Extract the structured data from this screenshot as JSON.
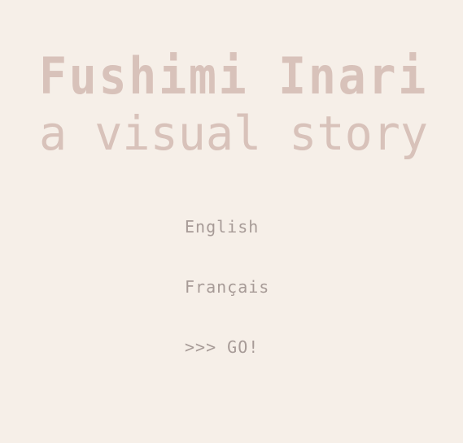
{
  "colors": {
    "background": "#f6efe8",
    "title": "#d8c2ba",
    "menu_text": "#a79b97"
  },
  "title": {
    "main": "Fushimi Inari",
    "subtitle": "a visual story"
  },
  "menu": {
    "items": [
      {
        "label": "English"
      },
      {
        "label": "Français"
      },
      {
        "label": ">>> GO!"
      }
    ]
  }
}
